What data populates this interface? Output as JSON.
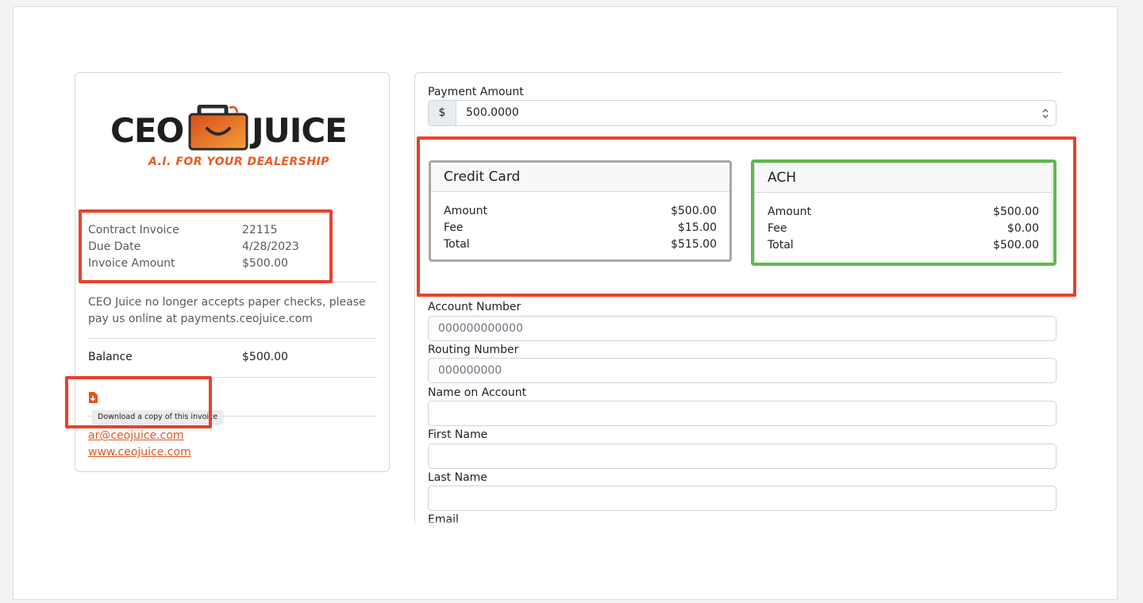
{
  "brand": {
    "left_word": "CEO",
    "right_word": "JUICE",
    "tagline": "A.I. FOR YOUR DEALERSHIP",
    "orange": "#ea5a22"
  },
  "invoice": {
    "rows": [
      {
        "label": "Contract Invoice",
        "value": "22115"
      },
      {
        "label": "Due Date",
        "value": "4/28/2023"
      },
      {
        "label": "Invoice Amount",
        "value": "$500.00"
      }
    ],
    "notice": "CEO Juice no longer accepts paper checks, please pay us online at payments.ceojuice.com",
    "balance_label": "Balance",
    "balance_value": "$500.00",
    "download_icon": "file-download-icon",
    "download_tooltip": "Download a copy of this invoice",
    "email_link": "ar@ceojuice.com",
    "website_link": "www.ceojuice.com"
  },
  "payment": {
    "amount_label": "Payment Amount",
    "currency_symbol": "$",
    "amount_value": "500.0000",
    "methods": [
      {
        "name": "Credit Card",
        "amount_label": "Amount",
        "amount": "$500.00",
        "fee_label": "Fee",
        "fee": "$15.00",
        "total_label": "Total",
        "total": "$515.00",
        "selected": false
      },
      {
        "name": "ACH",
        "amount_label": "Amount",
        "amount": "$500.00",
        "fee_label": "Fee",
        "fee": "$0.00",
        "total_label": "Total",
        "total": "$500.00",
        "selected": true
      }
    ],
    "fields": [
      {
        "label": "Account Number",
        "placeholder": "000000000000"
      },
      {
        "label": "Routing Number",
        "placeholder": "000000000"
      },
      {
        "label": "Name on Account",
        "placeholder": ""
      },
      {
        "label": "First Name",
        "placeholder": ""
      },
      {
        "label": "Last Name",
        "placeholder": ""
      },
      {
        "label": "Email",
        "placeholder": ""
      }
    ]
  },
  "annotation_colors": {
    "red": "#e8412c",
    "green": "#5fb94f"
  }
}
